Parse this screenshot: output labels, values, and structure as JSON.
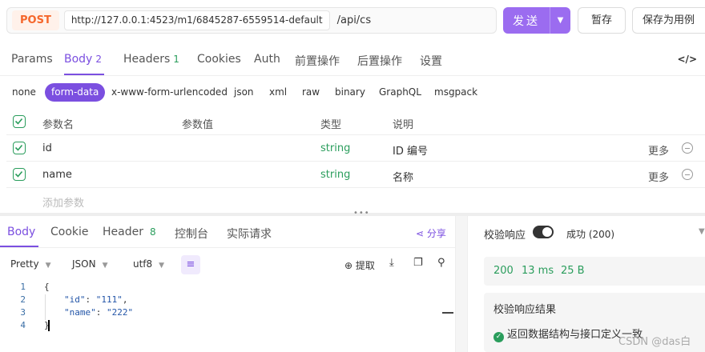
{
  "request": {
    "method": "POST",
    "env_url": "http://127.0.0.1:4523/m1/6845287-6559514-default",
    "path": "/api/cs",
    "send_label": "发送",
    "save_temp_label": "暂存",
    "save_case_label": "保存为用例"
  },
  "req_tabs": [
    {
      "label": "Params",
      "count": ""
    },
    {
      "label": "Body",
      "count": "2"
    },
    {
      "label": "Headers",
      "count": "1"
    },
    {
      "label": "Cookies",
      "count": ""
    },
    {
      "label": "Auth",
      "count": ""
    },
    {
      "label": "前置操作",
      "count": ""
    },
    {
      "label": "后置操作",
      "count": ""
    },
    {
      "label": "设置",
      "count": ""
    }
  ],
  "code_toggle": "</>",
  "body_types": [
    "none",
    "form-data",
    "x-www-form-urlencoded",
    "json",
    "xml",
    "raw",
    "binary",
    "GraphQL",
    "msgpack"
  ],
  "params": {
    "headers": {
      "name": "参数名",
      "value": "参数值",
      "type": "类型",
      "desc": "说明"
    },
    "rows": [
      {
        "name": "id",
        "value": "",
        "type": "string",
        "desc": "ID 编号",
        "more": "更多"
      },
      {
        "name": "name",
        "value": "",
        "type": "string",
        "desc": "名称",
        "more": "更多"
      }
    ],
    "add_placeholder": "添加参数"
  },
  "resp_tabs": [
    {
      "label": "Body",
      "count": ""
    },
    {
      "label": "Cookie",
      "count": ""
    },
    {
      "label": "Header",
      "count": "8"
    },
    {
      "label": "控制台",
      "count": ""
    },
    {
      "label": "实际请求",
      "count": ""
    }
  ],
  "share_label": "分享",
  "resp_tools": {
    "format": "Pretty",
    "lang": "JSON",
    "encoding": "utf8",
    "extract_label": "提取"
  },
  "code_lines": [
    {
      "num": "1",
      "text": "{"
    },
    {
      "num": "2",
      "key": "\"id\"",
      "sep": ": ",
      "val": "\"111\"",
      "end": ","
    },
    {
      "num": "3",
      "key": "\"name\"",
      "sep": ": ",
      "val": "\"222\"",
      "end": ""
    },
    {
      "num": "4",
      "text": "}"
    }
  ],
  "validate": {
    "label": "校验响应",
    "status": "成功 (200)",
    "metrics": {
      "code": "200",
      "time": "13 ms",
      "size": "25 B"
    },
    "result_title": "校验响应结果",
    "result_item": "返回数据结构与接口定义一致"
  },
  "watermark": "CSDN @das白",
  "colors": {
    "accent": "#7b4fe0",
    "success": "#2a9d5c",
    "method": "#f5662b"
  }
}
